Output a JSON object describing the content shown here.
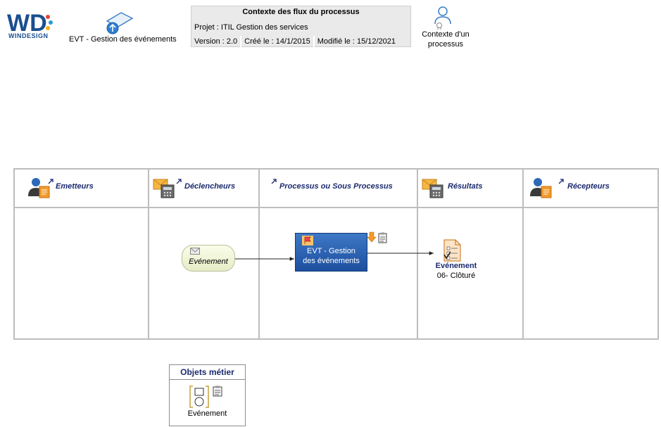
{
  "header": {
    "logo_text": "WINDESIGN",
    "process_title": "EVT - Gestion des événements",
    "cartouche": {
      "title": "Contexte des flux du processus",
      "project": "Projet : ITIL Gestion des services",
      "version": "Version : 2.0",
      "created": "Créé le : 14/1/2015",
      "modified": "Modifié le : 15/12/2021"
    },
    "context_label": "Contexte d'un processus"
  },
  "lanes": [
    {
      "label": "Emetteurs",
      "icon": "person-document-icon"
    },
    {
      "label": "Déclencheurs",
      "icon": "mail-phone-icon"
    },
    {
      "label": "Processus ou Sous Processus",
      "icon": "shortcut-arrow-icon"
    },
    {
      "label": "Résultats",
      "icon": "mail-phone-icon"
    },
    {
      "label": "Récepteurs",
      "icon": "person-document-icon"
    }
  ],
  "flow": {
    "trigger_label": "Evénement",
    "process_label_line1": "EVT - Gestion",
    "process_label_line2": "des événements",
    "result_title": "Evénement",
    "result_subtitle": "06- Clôturé"
  },
  "objets_metier": {
    "title": "Objets métier",
    "item_label": "Evénement"
  },
  "colors": {
    "lane_border": "#bdbdbd",
    "label_navy": "#1b2a6e",
    "process_blue": "#2a62b4",
    "trigger_fill": "#f1f5d8"
  }
}
